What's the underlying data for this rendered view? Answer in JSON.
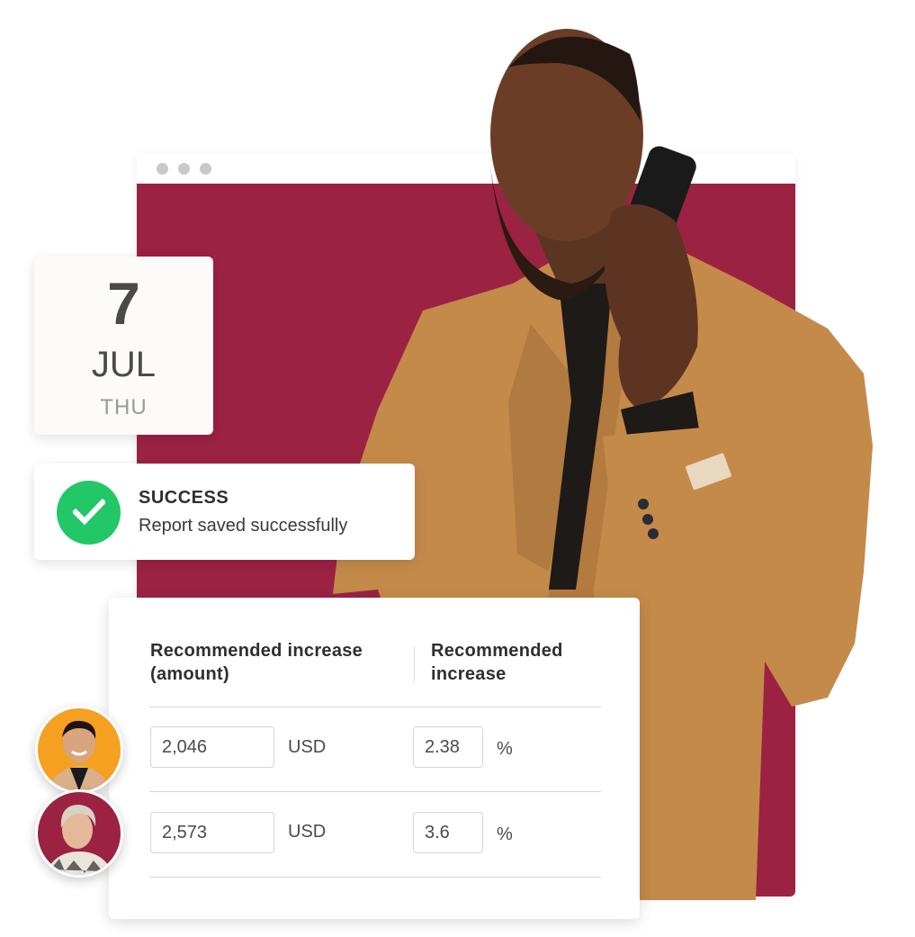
{
  "window": {
    "controls": [
      "window-dot-1",
      "window-dot-2",
      "window-dot-3"
    ],
    "content_color": "#9b2243"
  },
  "date_card": {
    "day": "7",
    "month": "JUL",
    "weekday": "THU"
  },
  "toast": {
    "icon": "check-circle-icon",
    "title": "SUCCESS",
    "message": "Report saved successfully",
    "color": "#22c767"
  },
  "table": {
    "headers": [
      "Recommended increase (amount)",
      "Recommended increase"
    ],
    "rows": [
      {
        "avatar": "avatar-man",
        "amount": "2,046",
        "currency": "USD",
        "percent": "2.38",
        "percent_sign": "%"
      },
      {
        "avatar": "avatar-woman",
        "amount": "2,573",
        "currency": "USD",
        "percent": "3.6",
        "percent_sign": "%"
      }
    ]
  },
  "colors": {
    "brand": "#9b2243",
    "success": "#22c767",
    "avatar_1_bg": "#f5a020",
    "avatar_2_bg": "#9b2243"
  }
}
